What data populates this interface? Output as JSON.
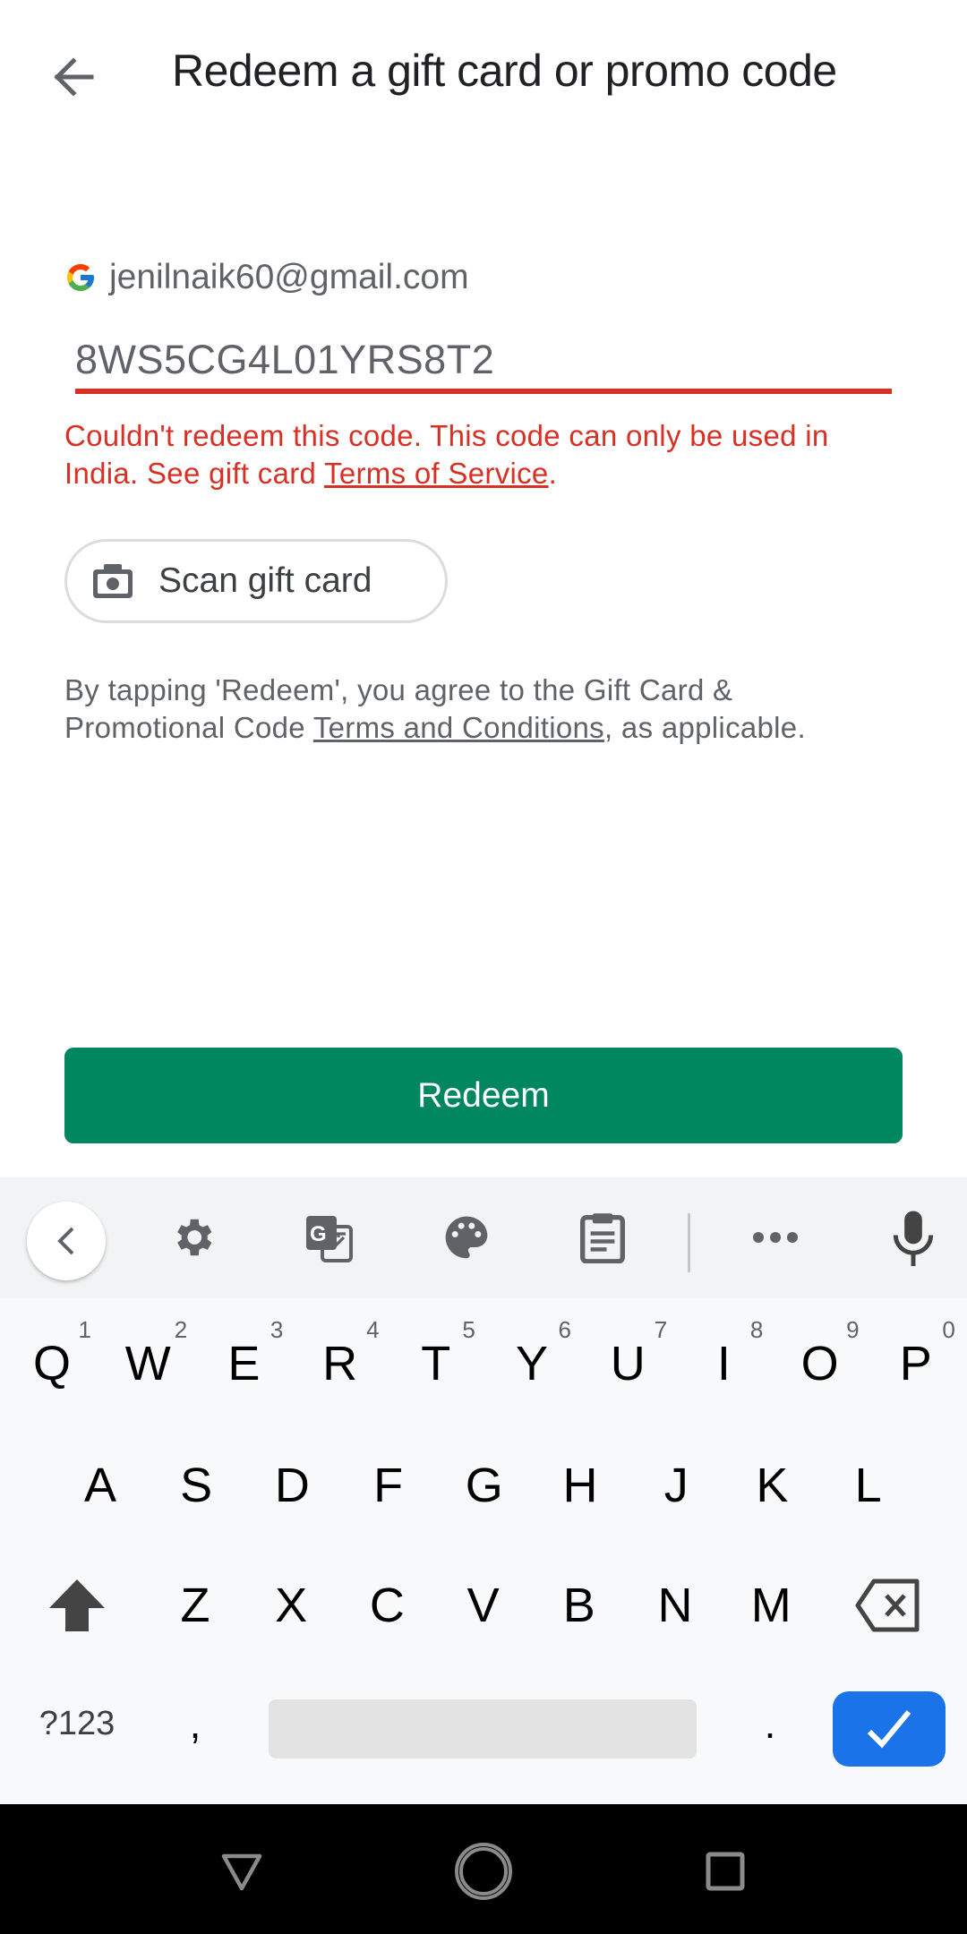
{
  "header": {
    "title": "Redeem a gift card or promo code",
    "back_icon": "arrow-back-icon"
  },
  "account": {
    "logo_icon": "google-g-icon",
    "email": "jenilnaik60@gmail.com"
  },
  "code_input": {
    "value": "8WS5CG4L01YRS8T2",
    "state": "error"
  },
  "error": {
    "text": "Couldn't redeem this code. This code can only be used in India. See gift card ",
    "link": "Terms of Service",
    "suffix": "."
  },
  "scan_button": {
    "icon": "camera-icon",
    "label": "Scan gift card"
  },
  "terms": {
    "prefix": "By tapping 'Redeem', you agree to the Gift Card & Promotional Code ",
    "link": "Terms and Conditions",
    "suffix": ", as applicable."
  },
  "redeem_button": {
    "label": "Redeem"
  },
  "colors": {
    "accent_green": "#01875f",
    "error_red": "#d93025",
    "keyboard_enter": "#1a73e8"
  },
  "keyboard": {
    "toolbar": [
      "collapse-icon",
      "settings-icon",
      "translate-icon",
      "theme-palette-icon",
      "clipboard-icon",
      "more-icon",
      "microphone-icon"
    ],
    "row1": [
      {
        "key": "Q",
        "hint": "1"
      },
      {
        "key": "W",
        "hint": "2"
      },
      {
        "key": "E",
        "hint": "3"
      },
      {
        "key": "R",
        "hint": "4"
      },
      {
        "key": "T",
        "hint": "5"
      },
      {
        "key": "Y",
        "hint": "6"
      },
      {
        "key": "U",
        "hint": "7"
      },
      {
        "key": "I",
        "hint": "8"
      },
      {
        "key": "O",
        "hint": "9"
      },
      {
        "key": "P",
        "hint": "0"
      }
    ],
    "row2": [
      "A",
      "S",
      "D",
      "F",
      "G",
      "H",
      "J",
      "K",
      "L"
    ],
    "row3": [
      "Z",
      "X",
      "C",
      "V",
      "B",
      "N",
      "M"
    ],
    "symbols_label": "?123",
    "comma": ",",
    "period": "."
  },
  "navbar": [
    "back-icon",
    "home-icon",
    "recents-icon"
  ]
}
